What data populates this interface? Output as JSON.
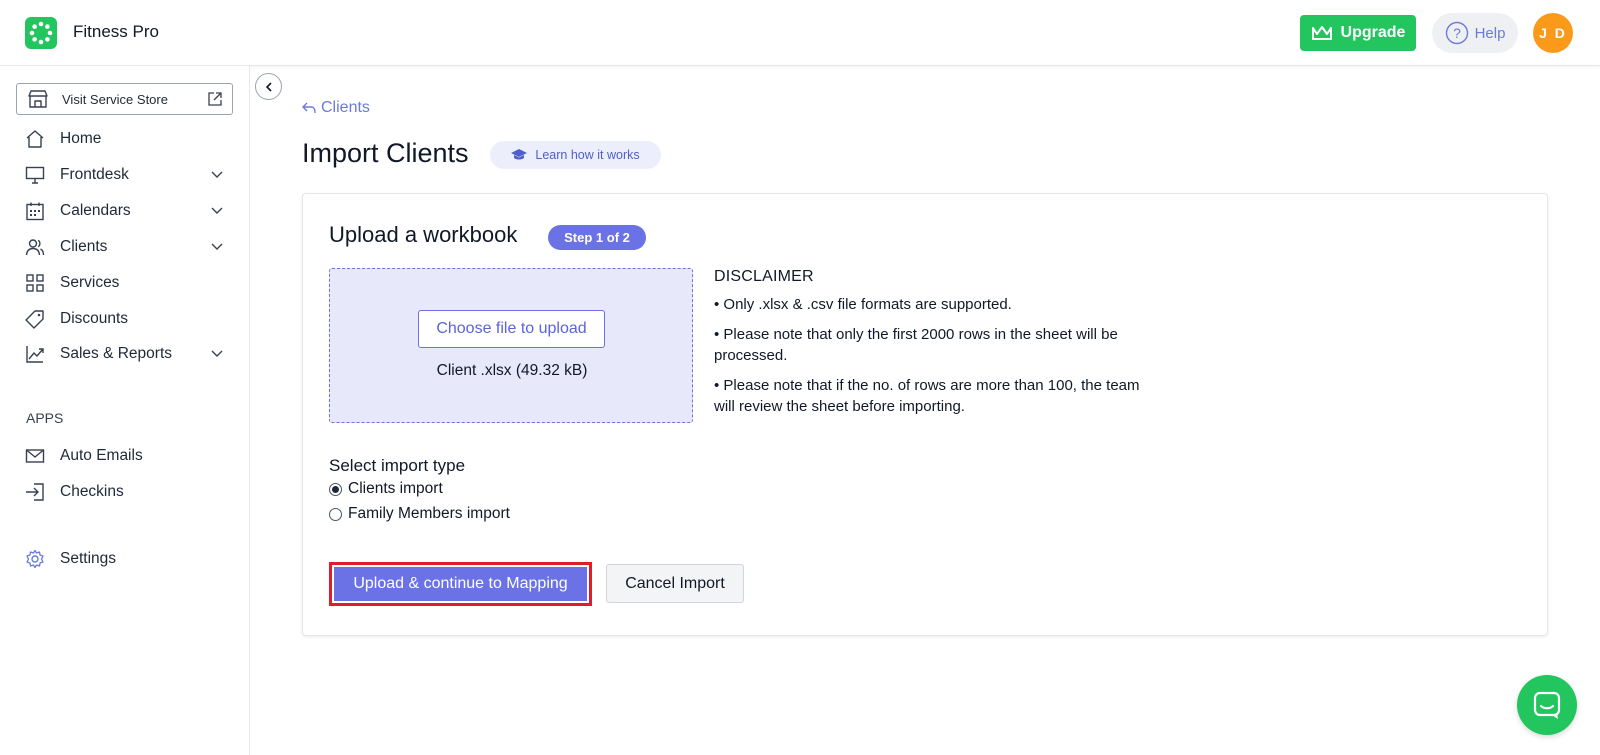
{
  "app": {
    "title": "Fitness Pro"
  },
  "header": {
    "upgrade_label": "Upgrade",
    "help_label": "Help",
    "avatar_initials": "J D",
    "colors": {
      "brand": "#22c55e",
      "avatar": "#fb9a1a",
      "accent": "#6b72e6"
    }
  },
  "sidebar": {
    "store_button": "Visit Service Store",
    "items": [
      {
        "label": "Home",
        "icon": "home-icon",
        "has_chevron": false
      },
      {
        "label": "Frontdesk",
        "icon": "monitor-icon",
        "has_chevron": true
      },
      {
        "label": "Calendars",
        "icon": "calendar-icon",
        "has_chevron": true
      },
      {
        "label": "Clients",
        "icon": "users-icon",
        "has_chevron": true
      },
      {
        "label": "Services",
        "icon": "grid-icon",
        "has_chevron": false
      },
      {
        "label": "Discounts",
        "icon": "tag-icon",
        "has_chevron": false
      },
      {
        "label": "Sales & Reports",
        "icon": "chart-icon",
        "has_chevron": true
      }
    ],
    "apps_heading": "APPS",
    "apps": [
      {
        "label": "Auto Emails",
        "icon": "mail-icon"
      },
      {
        "label": "Checkins",
        "icon": "login-icon"
      }
    ],
    "settings_label": "Settings"
  },
  "main": {
    "back_link": "Clients",
    "page_title": "Import Clients",
    "learn_label": "Learn how it works",
    "card": {
      "title": "Upload a workbook",
      "step_badge": "Step 1 of 2",
      "choose_button": "Choose file to upload",
      "file_name": "Client .xlsx (49.32 kB)",
      "disclaimer_title": "DISCLAIMER",
      "disclaimer_items": [
        "• Only .xlsx & .csv file formats are supported.",
        "• Please note that only the first 2000 rows in the sheet will be processed.",
        "• Please note that if the no. of rows are more than 100, the team will review the sheet before importing."
      ],
      "import_type_title": "Select import type",
      "import_options": [
        {
          "label": "Clients import",
          "selected": true
        },
        {
          "label": "Family Members import",
          "selected": false
        }
      ],
      "primary_button": "Upload & continue to Mapping",
      "cancel_button": "Cancel Import"
    }
  }
}
